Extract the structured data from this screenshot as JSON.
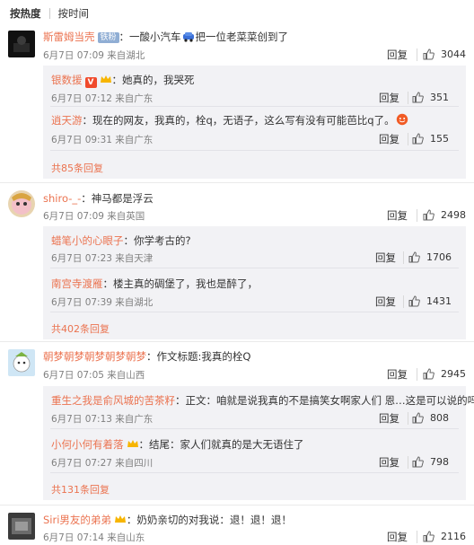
{
  "sort": {
    "hot_label": "按热度",
    "time_label": "按时间"
  },
  "reply_label": "回复",
  "comments": [
    {
      "user": "斯雷姆当壳",
      "badge": "铁粉",
      "text_a": "：一酸小汽车",
      "text_b": "把一位老菜菜创到了",
      "time": "6月7日 07:09 来自湖北",
      "likes": "3044",
      "subs": [
        {
          "user": "银数援",
          "text": "：她真的，我哭死",
          "time": "6月7日 07:12 来自广东",
          "likes": "351"
        },
        {
          "user": "逍天游",
          "text": "：现在的网友，我真的，栓q，无语子，这么写有没有可能芭比q了。",
          "time": "6月7日 09:31 来自广东",
          "likes": "155"
        }
      ],
      "more": "共85条回复"
    },
    {
      "user": "shiro-_-",
      "text": "：神马都是浮云",
      "time": "6月7日 07:09 来自英国",
      "likes": "2498",
      "subs": [
        {
          "user": "蜡笔小的心眼子",
          "text": "：你学考古的?",
          "time": "6月7日 07:23 来自天津",
          "likes": "1706"
        },
        {
          "user": "南宫寺渡雁",
          "text": "：楼主真的碉堡了，我也是醉了，",
          "time": "6月7日 07:39 来自湖北",
          "likes": "1431"
        }
      ],
      "more": "共402条回复"
    },
    {
      "user": "朝梦朝梦朝梦朝梦朝梦",
      "text": "：作文标题:我真的栓Q",
      "time": "6月7日 07:05 来自山西",
      "likes": "2945",
      "subs": [
        {
          "user": "重生之我是俞风城的苦茶籽",
          "text": "：正文：咱就是说我真的不是搞笑女啊家人们 恩…这是可以说的吗",
          "time": "6月7日 07:13 来自广东",
          "likes": "808"
        },
        {
          "user": "小何小何有着落",
          "text": "：结尾：家人们就真的是大无语住了",
          "time": "6月7日 07:27 来自四川",
          "likes": "798"
        }
      ],
      "more": "共131条回复"
    },
    {
      "user": "Siri男友的弟弟",
      "text": "：奶奶亲切的对我说：退！退！退！",
      "time": "6月7日 07:14 来自山东",
      "likes": "2116"
    }
  ],
  "icons": {
    "like": "thumbs-up-icon",
    "car_emoji": "car-emoji-icon",
    "smile_emoji": "smile-emoji-icon"
  },
  "colors": {
    "username": "#eb7350",
    "meta": "#808080",
    "subbox": "#f2f2f5"
  }
}
